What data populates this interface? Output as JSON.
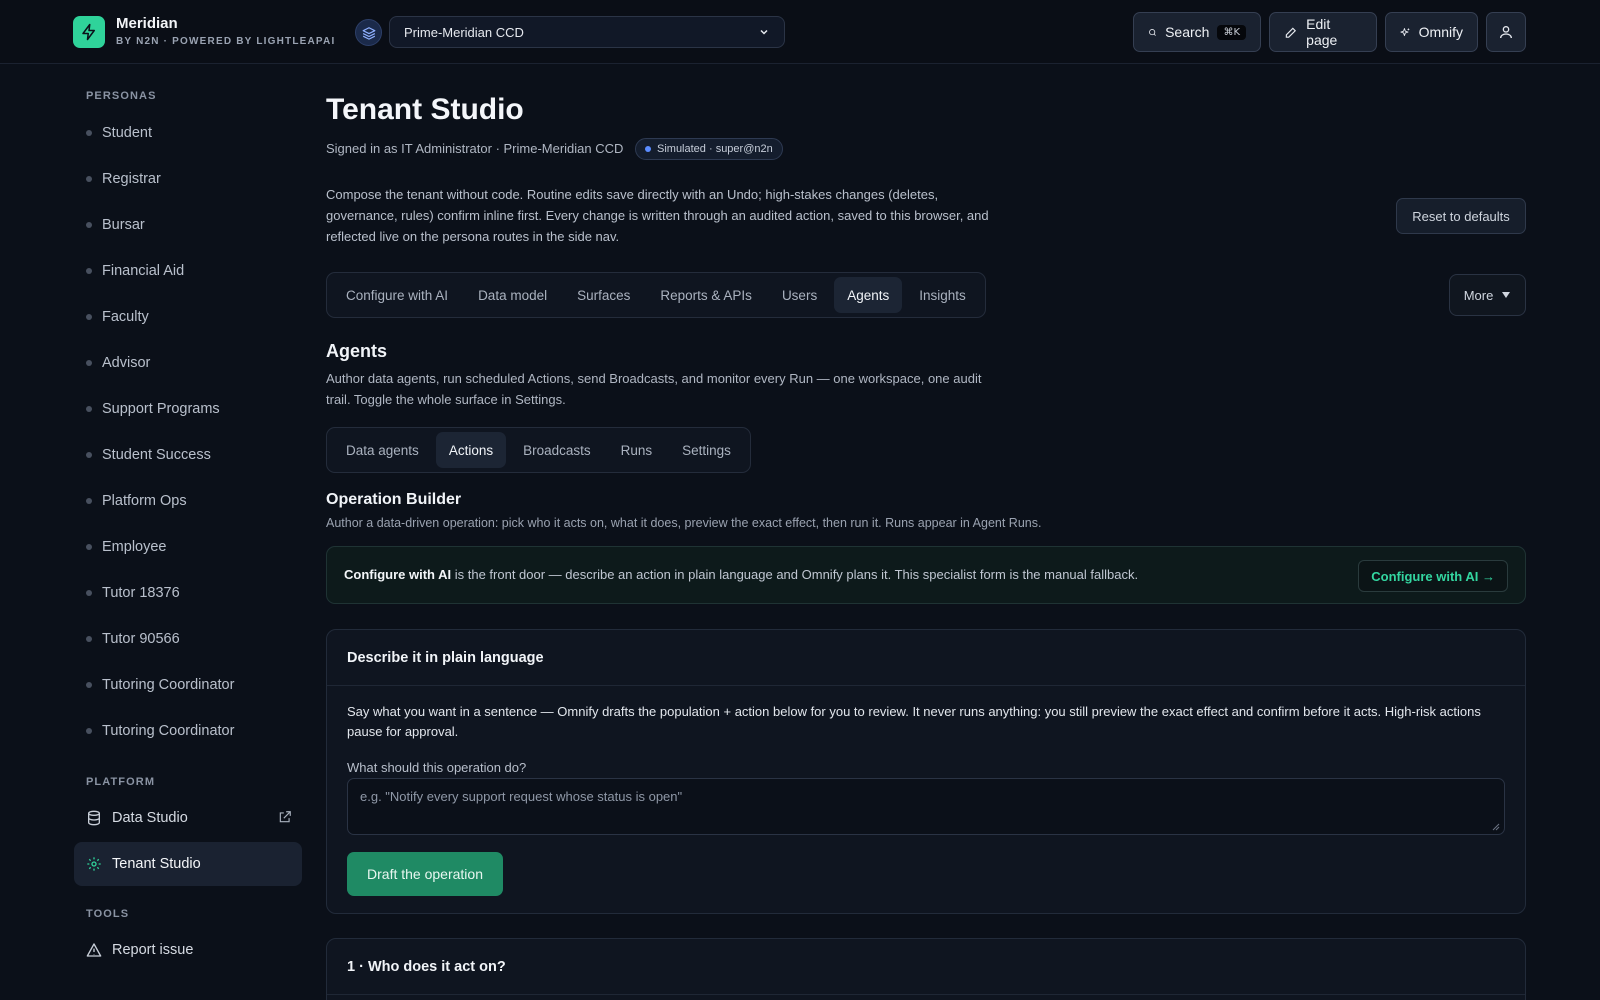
{
  "brand": {
    "name": "Meridian",
    "sub": "BY N2N · POWERED BY LIGHTLEAPAI",
    "accent": "#2fd39a"
  },
  "header": {
    "tenant_selected": "Prime-Meridian CCD",
    "search_label": "Search",
    "search_shortcut": "⌘K",
    "edit_label": "Edit page",
    "omnify_label": "Omnify"
  },
  "sidebar": {
    "personas_heading": "PERSONAS",
    "personas": [
      "Student",
      "Registrar",
      "Bursar",
      "Financial Aid",
      "Faculty",
      "Advisor",
      "Support Programs",
      "Student Success",
      "Platform Ops",
      "Employee",
      "Tutor 18376",
      "Tutor 90566",
      "Tutoring Coordinator",
      "Tutoring Coordinator"
    ],
    "platform_heading": "PLATFORM",
    "data_studio": "Data Studio",
    "tenant_studio": "Tenant Studio",
    "tools_heading": "TOOLS",
    "report_issue": "Report issue"
  },
  "main": {
    "title": "Tenant Studio",
    "signed_in": "Signed in as IT Administrator · Prime-Meridian CCD",
    "badge": "Simulated · super@n2n",
    "description": "Compose the tenant without code. Routine edits save directly with an Undo; high-stakes changes (deletes, governance, rules) confirm inline first. Every change is written through an audited action, saved to this browser, and reflected live on the persona routes in the side nav.",
    "reset_label": "Reset to defaults",
    "tabs": [
      "Configure with AI",
      "Data model",
      "Surfaces",
      "Reports & APIs",
      "Users",
      "Agents",
      "Insights"
    ],
    "active_tab": "Agents",
    "more_label": "More",
    "section": {
      "title": "Agents",
      "description": "Author data agents, run scheduled Actions, send Broadcasts, and monitor every Run — one workspace, one audit trail. Toggle the whole surface in Settings.",
      "subtabs": [
        "Data agents",
        "Actions",
        "Broadcasts",
        "Runs",
        "Settings"
      ],
      "active_subtab": "Actions"
    },
    "builder": {
      "title": "Operation Builder",
      "description": "Author a data-driven operation: pick who it acts on, what it does, preview the exact effect, then run it. Runs appear in Agent Runs.",
      "banner_bold": "Configure with AI",
      "banner_text": " is the front door — describe an action in plain language and Omnify plans it. This specialist form is the manual fallback.",
      "banner_button": "Configure with AI →"
    },
    "describe_card": {
      "title": "Describe it in plain language",
      "body": "Say what you want in a sentence — Omnify drafts the population + action below for you to review. It never runs anything: you still preview the exact effect and confirm before it acts. High-risk actions pause for approval.",
      "field_label": "What should this operation do?",
      "placeholder": "e.g. \"Notify every support request whose status is open\"",
      "button": "Draft the operation"
    },
    "step1_card": {
      "title": "1 · Who does it act on?"
    }
  }
}
